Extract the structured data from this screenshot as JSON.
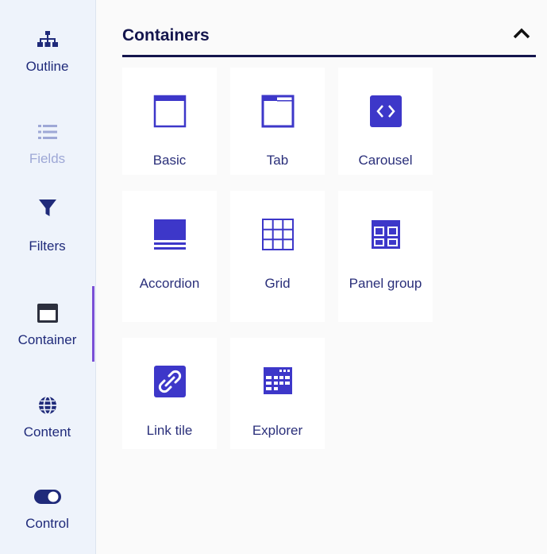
{
  "sidebar": {
    "items": [
      {
        "id": "outline",
        "label": "Outline",
        "icon": "sitemap-icon",
        "disabled": false
      },
      {
        "id": "fields",
        "label": "Fields",
        "icon": "list-icon",
        "disabled": true
      },
      {
        "id": "filters",
        "label": "Filters",
        "icon": "filter-icon",
        "disabled": false
      },
      {
        "id": "container",
        "label": "Container",
        "icon": "container-icon",
        "disabled": false,
        "active": true
      },
      {
        "id": "content",
        "label": "Content",
        "icon": "globe-icon",
        "disabled": false
      },
      {
        "id": "control",
        "label": "Control",
        "icon": "toggle-icon",
        "disabled": false
      }
    ]
  },
  "panel": {
    "title": "Containers",
    "collapse_icon": "chevron-up-icon"
  },
  "tiles": [
    {
      "label": "Basic",
      "icon": "basic-container-icon"
    },
    {
      "label": "Tab",
      "icon": "tab-container-icon"
    },
    {
      "label": "Carousel",
      "icon": "carousel-icon"
    },
    {
      "label": "Accordion",
      "icon": "accordion-icon"
    },
    {
      "label": "Grid",
      "icon": "grid-icon"
    },
    {
      "label": "Panel group",
      "icon": "panel-group-icon"
    },
    {
      "label": "Link tile",
      "icon": "link-icon"
    },
    {
      "label": "Explorer",
      "icon": "explorer-icon"
    }
  ],
  "colors": {
    "icon_dark": "#14154d",
    "accent": "#3d37c9",
    "active_indicator": "#7a4fd6",
    "disabled": "#9ea8d6"
  }
}
